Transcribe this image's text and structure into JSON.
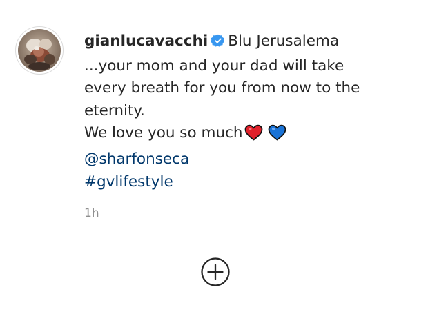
{
  "post": {
    "username": "gianlucavacchi",
    "verified": true,
    "caption_lines": [
      "Blu Jerusalema",
      "...your mom and your dad will take",
      "every breath for you from now to the",
      "eternity.",
      "We love you so much"
    ],
    "emojis": [
      "red-heart-icon",
      "blue-heart-icon"
    ],
    "mention": "@sharfonseca",
    "hashtag": "#gvlifestyle",
    "timestamp": "1h"
  },
  "icons": {
    "verified": "verified-badge-icon",
    "load_more": "plus-circle-icon"
  },
  "colors": {
    "text": "#262626",
    "link": "#00376b",
    "muted": "#8e8e8e",
    "verified": "#3897f0",
    "red_heart": "#e0212b",
    "blue_heart": "#1a73d6"
  }
}
